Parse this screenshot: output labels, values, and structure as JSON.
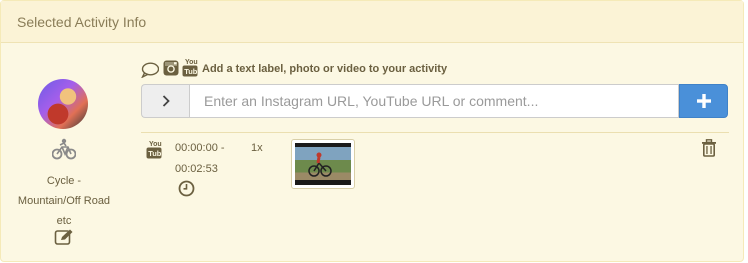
{
  "panel": {
    "title": "Selected Activity Info"
  },
  "activity": {
    "name_lines": [
      "Cycle -",
      "Mountain/Off Road",
      "etc"
    ],
    "icon": "mountain-bike-icon",
    "edit_icon": "edit-icon"
  },
  "add_media": {
    "hint": "Add a text label, photo or video to your activity",
    "hint_icons": [
      "comment-icon",
      "instagram-icon",
      "youtube-icon"
    ],
    "input_placeholder": "Enter an Instagram URL, YouTube URL or comment...",
    "input_value": "",
    "go_icon": "chevron-right-icon",
    "add_icon": "plus-icon"
  },
  "media_items": [
    {
      "type_icon": "youtube-icon",
      "time_start": "00:00:00 -",
      "time_end": "00:02:53",
      "speed": "1x",
      "clock_icon": "clock-icon",
      "delete_icon": "trash-icon"
    }
  ],
  "colors": {
    "panel_bg": "#fcf8e3",
    "header_bg": "#fbf3d6",
    "add_button": "#4a90d9",
    "text": "#6b6040"
  }
}
